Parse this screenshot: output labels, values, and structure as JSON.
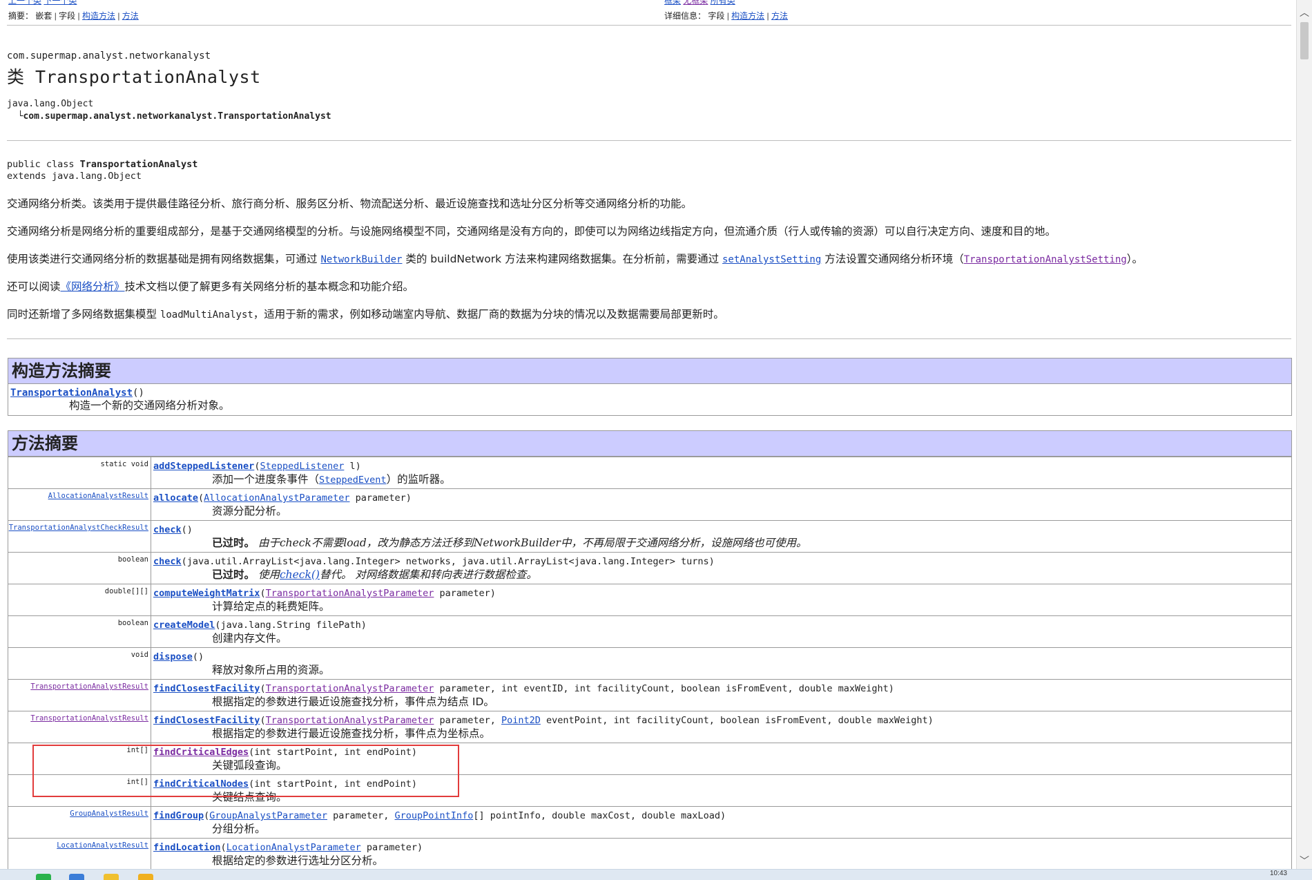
{
  "nav_top": {
    "left_cut": [
      "上一个类",
      "下一个类"
    ],
    "right_cut": [
      "框架",
      "无框架",
      "所有类"
    ]
  },
  "nav_summary": {
    "label": "摘要：",
    "items": [
      "嵌套",
      "字段",
      "构造方法",
      "方法"
    ]
  },
  "nav_detail": {
    "label": "详细信息：",
    "items": [
      "字段",
      "构造方法",
      "方法"
    ]
  },
  "package": "com.supermap.analyst.networkanalyst",
  "class_title": "类 TransportationAnalyst",
  "hierarchy": {
    "root": "java.lang.Object",
    "child": "com.supermap.analyst.networkanalyst.TransportationAnalyst"
  },
  "declaration": {
    "prefix": "public class ",
    "name": "TransportationAnalyst",
    "extends": "extends java.lang.Object"
  },
  "description": {
    "p1": "交通网络分析类。该类用于提供最佳路径分析、旅行商分析、服务区分析、物流配送分析、最近设施查找和选址分区分析等交通网络分析的功能。",
    "p2": "交通网络分析是网络分析的重要组成部分，是基于交通网络模型的分析。与设施网络模型不同，交通网络是没有方向的，即使可以为网络边线指定方向，但流通介质（行人或传输的资源）可以自行决定方向、速度和目的地。",
    "p3_a": "使用该类进行交通网络分析的数据基础是拥有网络数据集，可通过 ",
    "p3_link1": "NetworkBuilder",
    "p3_b": " 类的 buildNetwork 方法来构建网络数据集。在分析前，需要通过 ",
    "p3_link2": "setAnalystSetting",
    "p3_c": " 方法设置交通网络分析环境（",
    "p3_link3": "TransportationAnalystSetting",
    "p3_d": "）。",
    "p4_a": "还可以阅读",
    "p4_link": "《网络分析》",
    "p4_b": "技术文档以便了解更多有关网络分析的基本概念和功能介绍。",
    "p5_a": "同时还新增了多网络数据集模型 ",
    "p5_code": "loadMultiAnalyst",
    "p5_b": "，适用于新的需求，例如移动端室内导航、数据厂商的数据为分块的情况以及数据需要局部更新时。"
  },
  "constructor_summary": {
    "title": "构造方法摘要",
    "name": "TransportationAnalyst",
    "params": "()",
    "desc": "构造一个新的交通网络分析对象。"
  },
  "method_summary": {
    "title": "方法摘要",
    "rows": [
      {
        "ret": "static void",
        "name": "addSteppedListener",
        "p1": "(",
        "l1": "SteppedListener",
        "p2": " l)",
        "d1": "添加一个进度条事件（",
        "dl": "SteppedEvent",
        "d2": "）的监听器。"
      },
      {
        "ret": "AllocationAnalystResult",
        "name": "allocate",
        "p1": "(",
        "l1": "AllocationAnalystParameter",
        "p2": " parameter)",
        "desc": "资源分配分析。"
      },
      {
        "ret": "TransportationAnalystCheckResult",
        "name": "check",
        "p1": "()",
        "dep": "已过时。",
        "dep_text": " 由于check不需要load，改为静态方法迁移到NetworkBuilder中，不再局限于交通网络分析，设施网络也可使用。"
      },
      {
        "ret": "boolean",
        "name": "check",
        "p1": "(java.util.ArrayList<java.lang.Integer> networks, java.util.ArrayList<java.lang.Integer> turns)",
        "dep": "已过时。",
        "dep_a": " 使用",
        "dep_link": "check()",
        "dep_b": "替代。 对网络数据集和转向表进行数据检查。"
      },
      {
        "ret": "double[][]",
        "name": "computeWeightMatrix",
        "p1": "(",
        "l1": "TransportationAnalystParameter",
        "p2": " parameter)",
        "desc": "计算给定点的耗费矩阵。"
      },
      {
        "ret": "boolean",
        "name": "createModel",
        "p1": "(java.lang.String filePath)",
        "desc": "创建内存文件。"
      },
      {
        "ret": "void",
        "name": "dispose",
        "p1": "()",
        "desc": "释放对象所占用的资源。"
      },
      {
        "ret": "TransportationAnalystResult",
        "name": "findClosestFacility",
        "p1": "(",
        "l1": "TransportationAnalystParameter",
        "p2": " parameter, int eventID, int facilityCount, boolean isFromEvent, double maxWeight)",
        "desc": "根据指定的参数进行最近设施查找分析，事件点为结点 ID。"
      },
      {
        "ret": "TransportationAnalystResult",
        "name": "findClosestFacility",
        "p1": "(",
        "l1": "TransportationAnalystParameter",
        "p2": " parameter, ",
        "l2": "Point2D",
        "p3": " eventPoint, int facilityCount, boolean isFromEvent, double maxWeight)",
        "desc": "根据指定的参数进行最近设施查找分析，事件点为坐标点。"
      },
      {
        "ret": "int[]",
        "name": "findCriticalEdges",
        "p1": "(int startPoint, int endPoint)",
        "desc": "关键弧段查询。"
      },
      {
        "ret": "int[]",
        "name": "findCriticalNodes",
        "p1": "(int startPoint, int endPoint)",
        "desc": "关键结点查询。"
      },
      {
        "ret": "GroupAnalystResult",
        "name": "findGroup",
        "p1": "(",
        "l1": "GroupAnalystParameter",
        "p2": " parameter, ",
        "l2": "GroupPointInfo",
        "p3": "[] pointInfo, double maxCost, double maxLoad)",
        "desc": "分组分析。"
      },
      {
        "ret": "LocationAnalystResult",
        "name": "findLocation",
        "p1": "(",
        "l1": "LocationAnalystParameter",
        "p2": " parameter)",
        "desc": "根据给定的参数进行选址分区分析。"
      }
    ]
  },
  "taskbar": {
    "clock": "10:43"
  }
}
